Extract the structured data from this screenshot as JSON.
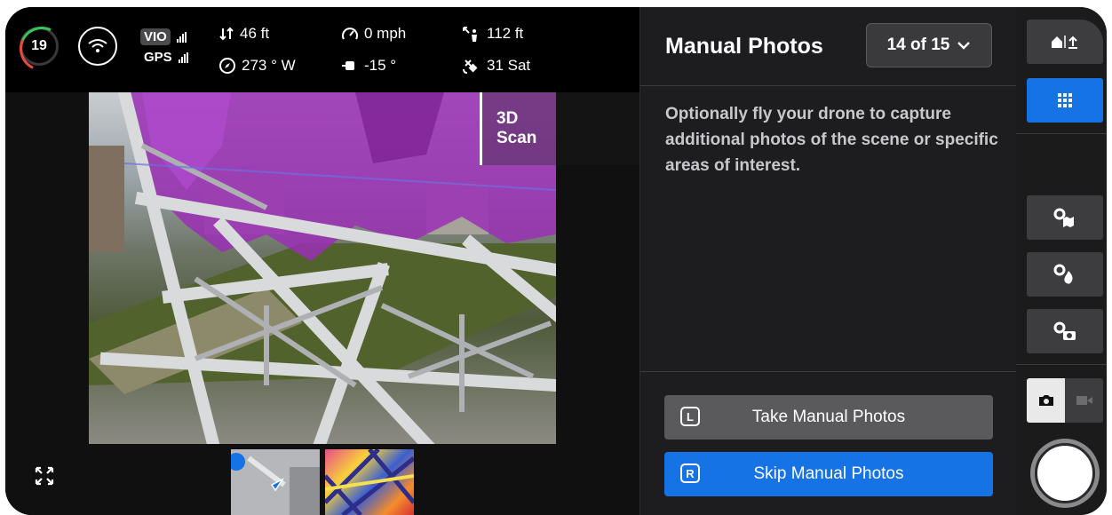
{
  "telemetry": {
    "battery": "19",
    "nav_vio": "VIO",
    "nav_gps": "GPS",
    "altitude": "46 ft",
    "heading": "273 ° W",
    "speed": "0 mph",
    "gimbal_pitch": "-15 °",
    "distance": "112 ft",
    "satellites": "31 Sat"
  },
  "feed": {
    "scan_label": "3D Scan"
  },
  "panel": {
    "title": "Manual Photos",
    "step": "14 of 15",
    "description": "Optionally fly your drone to capture additional photos of the scene or specific areas of interest.",
    "take_key": "L",
    "take_label": "Take Manual Photos",
    "skip_key": "R",
    "skip_label": "Skip Manual Photos"
  },
  "colors": {
    "accent_blue": "#1673e6",
    "scan_overlay": "#9b2fb5",
    "battery_green": "#35c759",
    "battery_red": "#e74c3c"
  },
  "icons": [
    "wifi-icon",
    "altitude-icon",
    "compass-icon",
    "speed-icon",
    "gimbal-icon",
    "distance-icon",
    "satellite-icon",
    "expand-icon",
    "chevron-down-icon",
    "home-upload-icon",
    "grid-icon",
    "settings-map-icon",
    "settings-fire-icon",
    "settings-camera-icon",
    "camera-icon",
    "video-icon"
  ]
}
